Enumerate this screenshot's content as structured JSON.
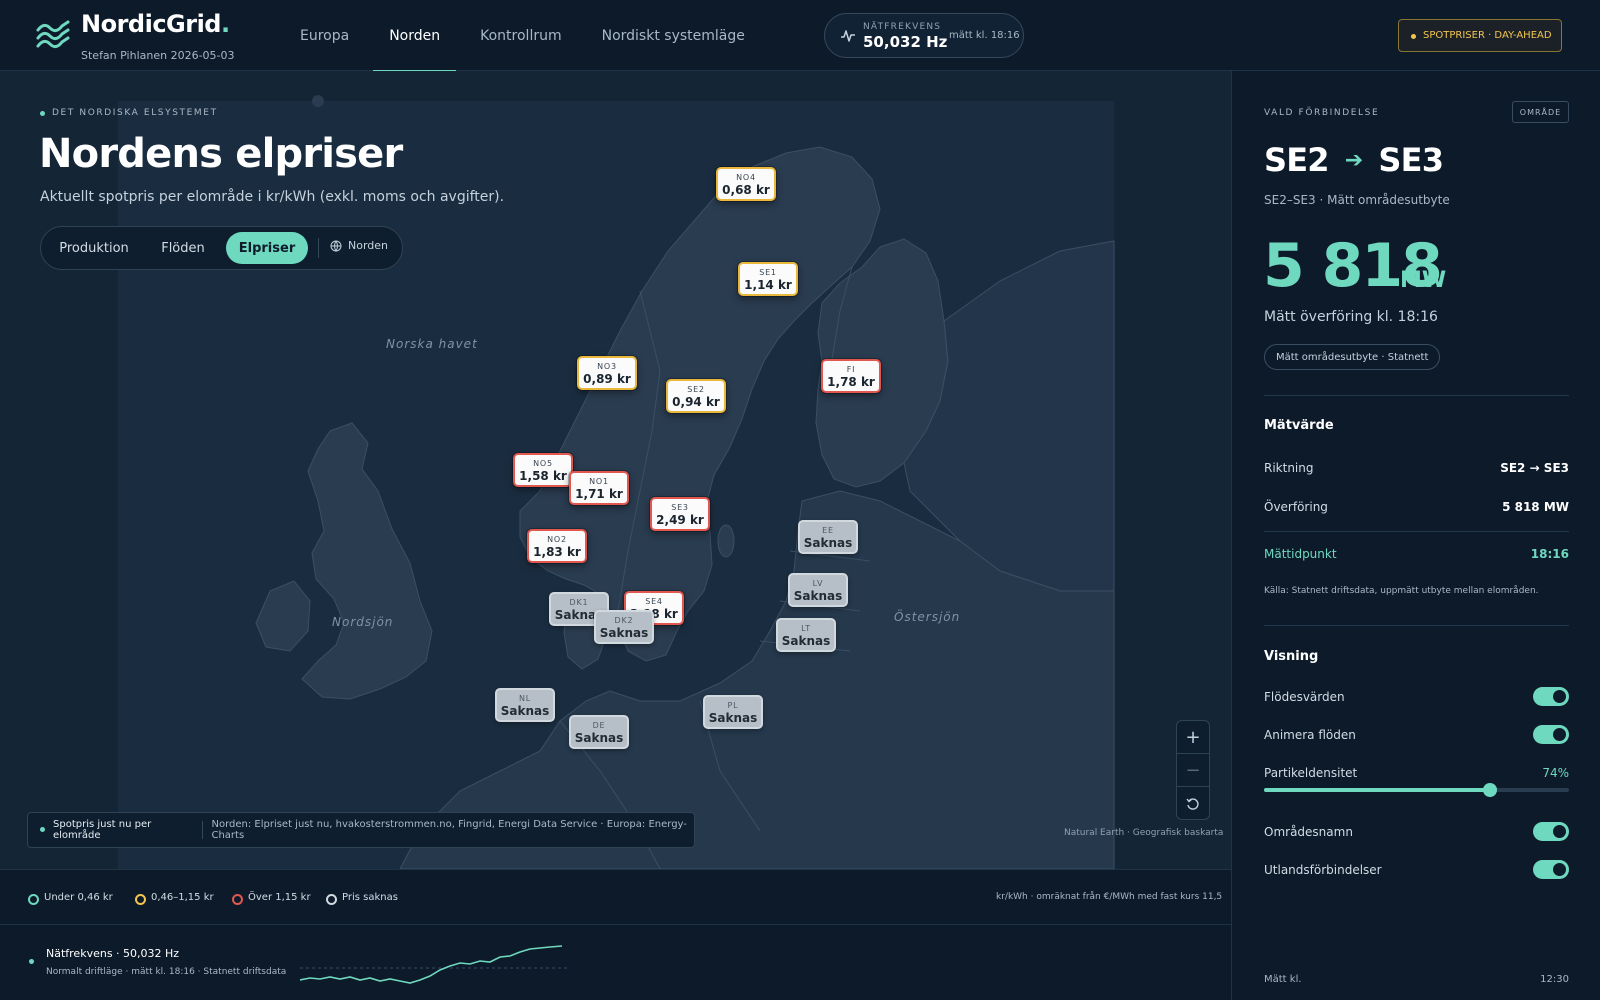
{
  "header": {
    "brand": "NordicGrid",
    "brand_dot": ".",
    "subtitle": "Stefan Pihlanen 2026-05-03",
    "nav": [
      {
        "label": "Europa",
        "active": false
      },
      {
        "label": "Norden",
        "active": true
      },
      {
        "label": "Kontrollrum",
        "active": false
      },
      {
        "label": "Nordiskt systemläge",
        "active": false
      }
    ],
    "frequency": {
      "label": "NÄTFREKVENS",
      "value": "50,032 Hz",
      "time": "mätt kl. 18:16"
    },
    "spot_badge": "SPOTPRISER · DAY-AHEAD"
  },
  "map": {
    "eyebrow": "DET NORDISKA ELSYSTEMET",
    "title": "Nordens elpriser",
    "subtitle": "Aktuellt spotpris per elområde i kr/kWh (exkl. moms och avgifter).",
    "segments": [
      {
        "label": "Produktion",
        "active": false
      },
      {
        "label": "Flöden",
        "active": false
      },
      {
        "label": "Elpriser",
        "active": true
      }
    ],
    "region_button": "Norden",
    "seas": [
      "Norska havet",
      "Nordsjön",
      "Östersjön"
    ],
    "zones": [
      {
        "code": "NO4",
        "price": "0,68 kr",
        "level": "mid"
      },
      {
        "code": "SE1",
        "price": "1,14 kr",
        "level": "mid"
      },
      {
        "code": "NO3",
        "price": "0,89 kr",
        "level": "mid"
      },
      {
        "code": "SE2",
        "price": "0,94 kr",
        "level": "mid"
      },
      {
        "code": "FI",
        "price": "1,78 kr",
        "level": "high"
      },
      {
        "code": "NO5",
        "price": "1,58 kr",
        "level": "high"
      },
      {
        "code": "NO1",
        "price": "1,71 kr",
        "level": "high"
      },
      {
        "code": "SE3",
        "price": "2,49 kr",
        "level": "high"
      },
      {
        "code": "NO2",
        "price": "1,83 kr",
        "level": "high"
      },
      {
        "code": "EE",
        "price": "Saknas",
        "level": "missing"
      },
      {
        "code": "LV",
        "price": "Saknas",
        "level": "missing"
      },
      {
        "code": "LT",
        "price": "Saknas",
        "level": "missing"
      },
      {
        "code": "SE4",
        "price": "2,98 kr",
        "level": "high"
      },
      {
        "code": "DK1",
        "price": "Saknas",
        "level": "missing"
      },
      {
        "code": "DK2",
        "price": "Saknas",
        "level": "missing"
      },
      {
        "code": "NL",
        "price": "Saknas",
        "level": "missing"
      },
      {
        "code": "DE",
        "price": "Saknas",
        "level": "missing"
      },
      {
        "code": "PL",
        "price": "Saknas",
        "level": "missing"
      }
    ],
    "zoom": {
      "plus": "+",
      "minus": "−",
      "reset_icon": "reset-icon"
    },
    "source_label": "Spotpris just nu per elområde",
    "source_text": "Norden: Elpriset just nu, hvakosterstrommen.no, Fingrid, Energi Data Service · Europa: Energy-Charts",
    "attribution": "Natural Earth · Geografisk baskarta"
  },
  "legend": {
    "items": [
      {
        "label": "Under 0,46 kr",
        "color": "#6fd9c0"
      },
      {
        "label": "0,46–1,15 kr",
        "color": "#f3c54c"
      },
      {
        "label": "Över 1,15 kr",
        "color": "#e2574f"
      },
      {
        "label": "Pris saknas",
        "color": "#d1d8de"
      }
    ],
    "note": "kr/kWh · omräknat från €/MWh med fast kurs 11,5"
  },
  "bottom": {
    "title": "Nätfrekvens · 50,032 Hz",
    "sub": "Normalt driftläge · mätt kl. 18:16 · Statnett driftsdata"
  },
  "panel": {
    "eyebrow": "VALD FÖRBINDELSE",
    "badge": "OMRÅDE",
    "from": "SE2",
    "to": "SE3",
    "sub": "SE2–SE3 · Mätt områdesutbyte",
    "big_value": "5 818",
    "unit": "MW",
    "caption": "Mätt överföring kl. 18:16",
    "tag": "Mätt områdesutbyte · Statnett",
    "measure_heading": "Mätvärde",
    "rows": [
      {
        "label": "Riktning",
        "value": "SE2 → SE3"
      },
      {
        "label": "Överföring",
        "value": "5 818 MW"
      },
      {
        "label": "Mättidpunkt",
        "value": "18:16"
      }
    ],
    "source": "Källa: Statnett driftsdata, uppmätt utbyte mellan elområden.",
    "view_heading": "Visning",
    "toggles": [
      {
        "label": "Flödesvärden",
        "on": true
      },
      {
        "label": "Animera flöden",
        "on": true
      },
      {
        "label": "Områdesnamn",
        "on": true
      },
      {
        "label": "Utlandsförbindelser",
        "on": true
      }
    ],
    "slider": {
      "label": "Partikeldensitet",
      "value_text": "74%",
      "value": 0.74
    },
    "footer_label": "Mätt kl.",
    "footer_value": "12:30"
  }
}
